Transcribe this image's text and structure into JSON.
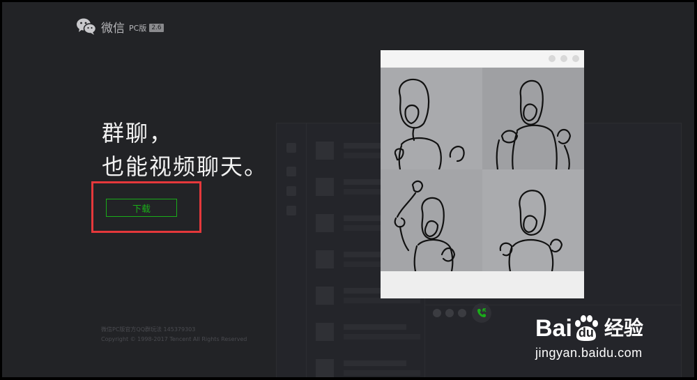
{
  "header": {
    "app_name": "微信",
    "platform": "PC版",
    "version": "2.6"
  },
  "hero": {
    "line1": "群聊，",
    "line2": "也能视频聊天。",
    "download_label": "下载"
  },
  "footer": {
    "line1": "微信PC版官方QQ群玩法 145379303",
    "line2": "Copyright © 1998-2017 Tencent All Rights Reserved"
  },
  "watermark": {
    "brand_part1": "Bai",
    "brand_du": "du",
    "brand_cn": "经验",
    "url": "jingyan.baidu.com"
  },
  "colors": {
    "accent_green": "#1aad19",
    "highlight_red": "#e5383b",
    "background": "#222326"
  },
  "icons": [
    "wechat-logo-icon",
    "phone-call-icon",
    "baidu-paw-icon"
  ]
}
